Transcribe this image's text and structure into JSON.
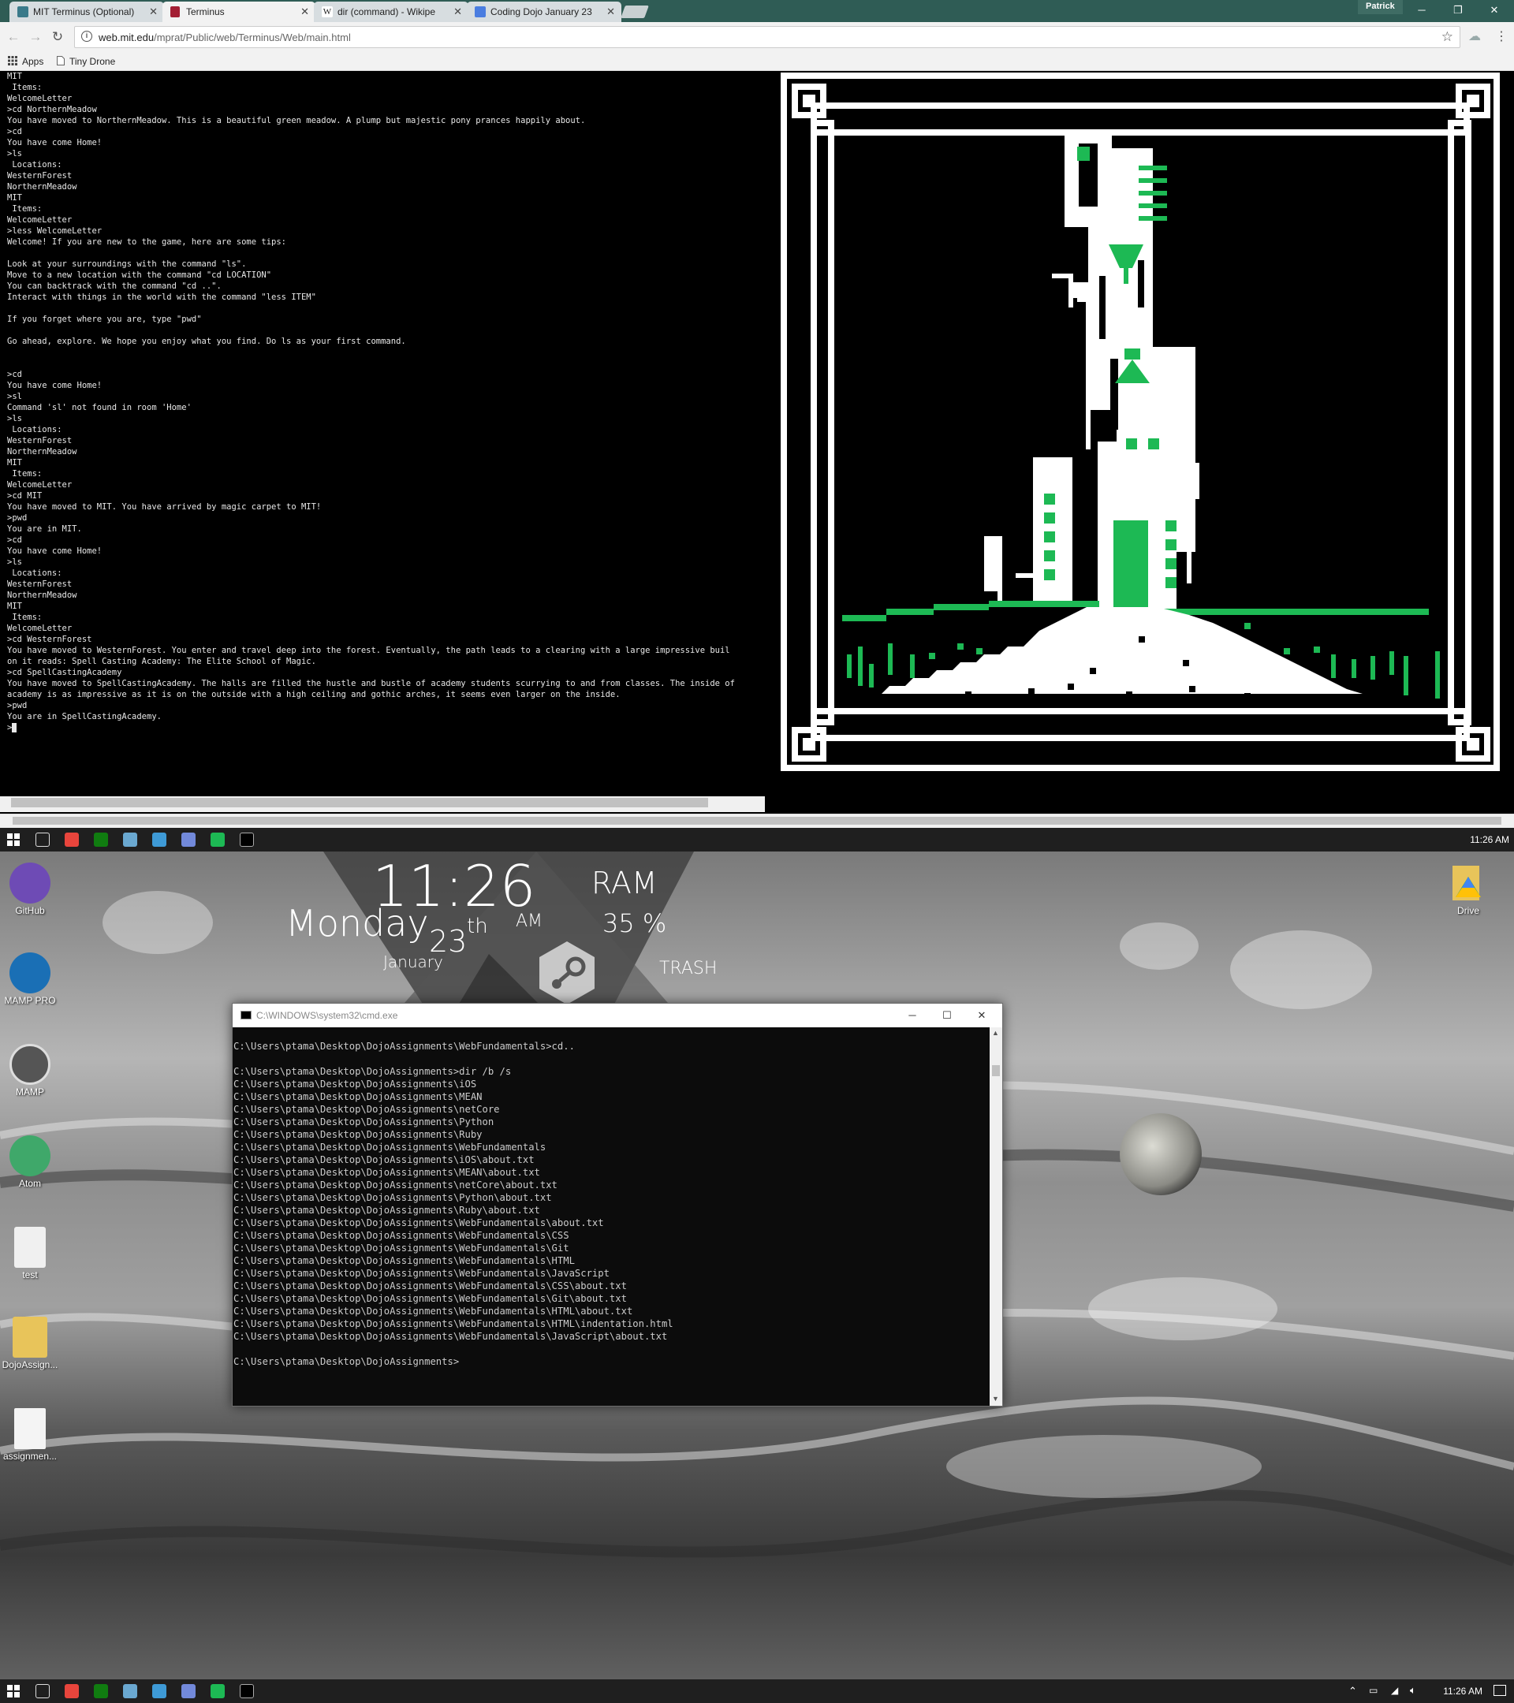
{
  "browser": {
    "tabs": [
      {
        "title": "MIT Terminus (Optional)",
        "favicon_color": "#3a7a8a",
        "active": false
      },
      {
        "title": "Terminus",
        "favicon_color": "#a31f34",
        "active": true
      },
      {
        "title": "dir (command) - Wikipe",
        "favicon_color": "#888888",
        "active": false
      },
      {
        "title": "Coding Dojo January 23",
        "favicon_color": "#4a7de0",
        "active": false
      }
    ],
    "profile_name": "Patrick",
    "url_host": "web.mit.edu",
    "url_path": "/mprat/Public/web/Terminus/Web/main.html",
    "bookmarks": [
      {
        "label": "Apps",
        "icon": "apps-grid-icon"
      },
      {
        "label": "Tiny Drone",
        "icon": "page-icon"
      }
    ]
  },
  "terminal": {
    "lines": [
      "MIT",
      " Items:",
      "WelcomeLetter",
      ">cd NorthernMeadow",
      "You have moved to NorthernMeadow. This is a beautiful green meadow. A plump but majestic pony prances happily about.",
      ">cd",
      "You have come Home!",
      ">ls",
      " Locations:",
      "WesternForest",
      "NorthernMeadow",
      "MIT",
      " Items:",
      "WelcomeLetter",
      ">less WelcomeLetter",
      "Welcome! If you are new to the game, here are some tips:",
      "",
      "Look at your surroundings with the command \"ls\".",
      "Move to a new location with the command \"cd LOCATION\"",
      "You can backtrack with the command \"cd ..\".",
      "Interact with things in the world with the command \"less ITEM\"",
      "",
      "If you forget where you are, type \"pwd\"",
      "",
      "Go ahead, explore. We hope you enjoy what you find. Do ls as your first command.",
      "",
      "",
      ">cd",
      "You have come Home!",
      ">sl",
      "Command 'sl' not found in room 'Home'",
      ">ls",
      " Locations:",
      "WesternForest",
      "NorthernMeadow",
      "MIT",
      " Items:",
      "WelcomeLetter",
      ">cd MIT",
      "You have moved to MIT. You have arrived by magic carpet to MIT!",
      ">pwd",
      "You are in MIT.",
      ">cd",
      "You have come Home!",
      ">ls",
      " Locations:",
      "WesternForest",
      "NorthernMeadow",
      "MIT",
      " Items:",
      "WelcomeLetter",
      ">cd WesternForest",
      "You have moved to WesternForest. You enter and travel deep into the forest. Eventually, the path leads to a clearing with a large impressive buil",
      "on it reads: Spell Casting Academy: The Elite School of Magic.",
      ">cd SpellCastingAcademy",
      "You have moved to SpellCastingAcademy. The halls are filled the hustle and bustle of academy students scurrying to and from classes. The inside of",
      "academy is as impressive as it is on the outside with a high ceiling and gothic arches, it seems even larger on the inside.",
      ">pwd",
      "You are in SpellCastingAcademy.",
      ">"
    ]
  },
  "taskbar": {
    "time": "11:26 AM",
    "app_icons": [
      "windows-start-icon",
      "task-view-icon",
      "chrome-icon",
      "xbox-icon",
      "steam-icon",
      "visual-studio-icon",
      "discord-icon",
      "spotify-icon",
      "cmd-icon"
    ]
  },
  "desktop": {
    "icons_left": [
      {
        "label": "GitHub",
        "icon": "github-icon"
      },
      {
        "label": "MAMP PRO",
        "icon": "mamp-pro-icon"
      },
      {
        "label": "MAMP",
        "icon": "mamp-icon"
      },
      {
        "label": "Atom",
        "icon": "atom-icon"
      },
      {
        "label": "test",
        "icon": "chrome-html-file-icon"
      },
      {
        "label": "DojoAssign...",
        "icon": "folder-icon"
      },
      {
        "label": "assignmen...",
        "icon": "text-file-icon"
      }
    ],
    "icons_right": [
      {
        "label": "Drive",
        "icon": "google-drive-icon"
      }
    ],
    "widget": {
      "time": "11:26",
      "day": "Monday",
      "date": "23",
      "date_suffix": "th",
      "month": "January",
      "ampm": "AM",
      "ram_label": "RAM",
      "ram_value": "35 %",
      "trash_label": "TRASH"
    }
  },
  "cmd": {
    "title": "C:\\WINDOWS\\system32\\cmd.exe",
    "lines": [
      "C:\\Users\\ptama\\Desktop\\DojoAssignments\\WebFundamentals>cd..",
      "",
      "C:\\Users\\ptama\\Desktop\\DojoAssignments>dir /b /s",
      "C:\\Users\\ptama\\Desktop\\DojoAssignments\\iOS",
      "C:\\Users\\ptama\\Desktop\\DojoAssignments\\MEAN",
      "C:\\Users\\ptama\\Desktop\\DojoAssignments\\netCore",
      "C:\\Users\\ptama\\Desktop\\DojoAssignments\\Python",
      "C:\\Users\\ptama\\Desktop\\DojoAssignments\\Ruby",
      "C:\\Users\\ptama\\Desktop\\DojoAssignments\\WebFundamentals",
      "C:\\Users\\ptama\\Desktop\\DojoAssignments\\iOS\\about.txt",
      "C:\\Users\\ptama\\Desktop\\DojoAssignments\\MEAN\\about.txt",
      "C:\\Users\\ptama\\Desktop\\DojoAssignments\\netCore\\about.txt",
      "C:\\Users\\ptama\\Desktop\\DojoAssignments\\Python\\about.txt",
      "C:\\Users\\ptama\\Desktop\\DojoAssignments\\Ruby\\about.txt",
      "C:\\Users\\ptama\\Desktop\\DojoAssignments\\WebFundamentals\\about.txt",
      "C:\\Users\\ptama\\Desktop\\DojoAssignments\\WebFundamentals\\CSS",
      "C:\\Users\\ptama\\Desktop\\DojoAssignments\\WebFundamentals\\Git",
      "C:\\Users\\ptama\\Desktop\\DojoAssignments\\WebFundamentals\\HTML",
      "C:\\Users\\ptama\\Desktop\\DojoAssignments\\WebFundamentals\\JavaScript",
      "C:\\Users\\ptama\\Desktop\\DojoAssignments\\WebFundamentals\\CSS\\about.txt",
      "C:\\Users\\ptama\\Desktop\\DojoAssignments\\WebFundamentals\\Git\\about.txt",
      "C:\\Users\\ptama\\Desktop\\DojoAssignments\\WebFundamentals\\HTML\\about.txt",
      "C:\\Users\\ptama\\Desktop\\DojoAssignments\\WebFundamentals\\HTML\\indentation.html",
      "C:\\Users\\ptama\\Desktop\\DojoAssignments\\WebFundamentals\\JavaScript\\about.txt",
      "",
      "C:\\Users\\ptama\\Desktop\\DojoAssignments>"
    ]
  },
  "colors": {
    "tabstrip": "#2f5c55",
    "pixel_green": "#1db954",
    "terminal_bg": "#000000",
    "taskbar_bg": "#1f1f1f"
  }
}
